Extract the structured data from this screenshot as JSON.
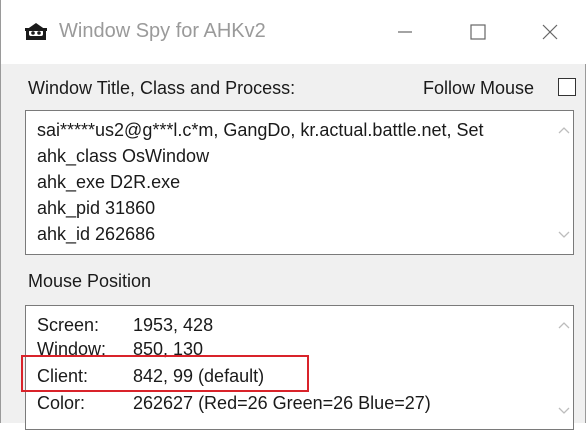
{
  "window": {
    "title": "Window Spy for AHKv2",
    "icon": "window-spy-icon",
    "controls": [
      "minimize-icon",
      "maximize-icon",
      "close-icon"
    ]
  },
  "window_section": {
    "label": "Window Title, Class and Process:",
    "follow_mouse_label": "Follow Mouse",
    "follow_mouse_checked": false,
    "lines": [
      "sai*****us2@g***l.c*m, GangDo, kr.actual.battle.net, Set",
      "ahk_class OsWindow",
      "ahk_exe D2R.exe",
      "ahk_pid 31860",
      "ahk_id 262686"
    ]
  },
  "mouse_section": {
    "label": "Mouse Position",
    "rows": [
      {
        "key": "Screen:",
        "value": "1953, 428"
      },
      {
        "key": "Window:",
        "value": "850, 130"
      },
      {
        "key": "Client:",
        "value": "842, 99 (default)"
      },
      {
        "key": "Color:",
        "value": "262627 (Red=26 Green=26 Blue=27)"
      }
    ],
    "highlighted_row": "Client:"
  },
  "colors": {
    "highlight": "#d9232a",
    "panel": "#f0f0f0",
    "title_text": "#9a9a9a"
  }
}
